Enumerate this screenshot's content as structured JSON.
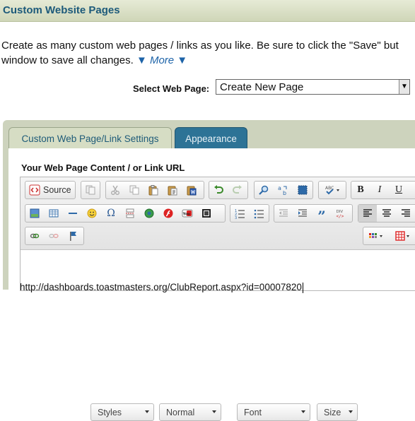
{
  "header": {
    "title": "Custom Website Pages"
  },
  "intro": {
    "line1": "Create as many custom web pages / links as you like. Be sure to click the \"Save\" but",
    "line2": "window to save all changes.",
    "more_link": "▼ More ▼"
  },
  "page_select": {
    "label": "Select Web Page:",
    "value": "Create New Page"
  },
  "tabs": [
    {
      "label": "Custom Web Page/Link Settings",
      "active": false
    },
    {
      "label": "Appearance",
      "active": true
    }
  ],
  "editor": {
    "content_label": "Your Web Page Content / or Link URL",
    "source_label": "Source",
    "styles_label": "Styles",
    "format_label": "Normal",
    "font_label": "Font",
    "size_label": "Size",
    "content_text": "http://dashboards.toastmasters.org/ClubReport.aspx?id=00007820"
  },
  "colors": {
    "title_text": "#1d5a7a",
    "active_tab": "#2d7396",
    "link": "#1d63a8",
    "panel_bg": "#cdd3bd"
  }
}
